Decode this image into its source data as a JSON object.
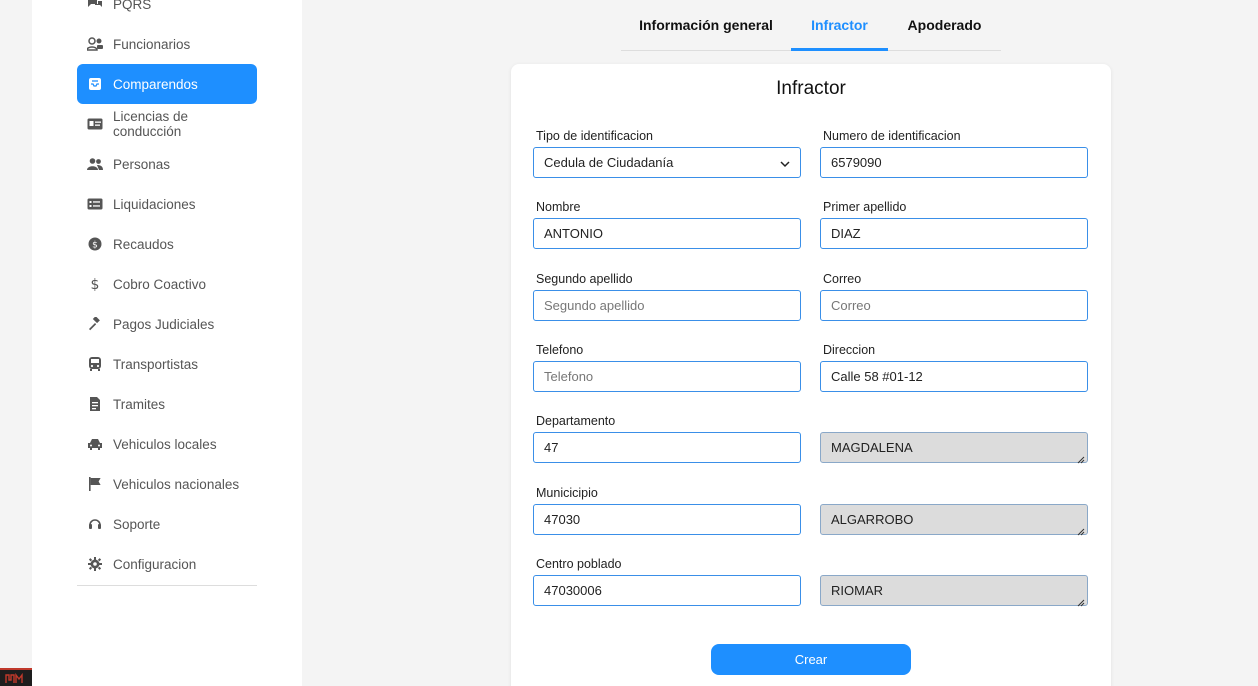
{
  "sidebar": {
    "items": [
      {
        "label": "PQRS",
        "icon": "chat-icon"
      },
      {
        "label": "Funcionarios",
        "icon": "users-icon"
      },
      {
        "label": "Comparendos",
        "icon": "inbox-icon",
        "active": true
      },
      {
        "label": "Licencias de conducción",
        "icon": "id-card-icon"
      },
      {
        "label": "Personas",
        "icon": "people-icon"
      },
      {
        "label": "Liquidaciones",
        "icon": "list-card-icon"
      },
      {
        "label": "Recaudos",
        "icon": "money-icon"
      },
      {
        "label": "Cobro Coactivo",
        "icon": "dollar-icon"
      },
      {
        "label": "Pagos Judiciales",
        "icon": "gavel-icon"
      },
      {
        "label": "Transportistas",
        "icon": "bus-icon"
      },
      {
        "label": "Tramites",
        "icon": "document-icon"
      },
      {
        "label": "Vehiculos locales",
        "icon": "car-icon"
      },
      {
        "label": "Vehiculos nacionales",
        "icon": "flag-icon"
      },
      {
        "label": "Soporte",
        "icon": "headset-icon"
      },
      {
        "label": "Configuracion",
        "icon": "gear-icon"
      }
    ]
  },
  "tabs": [
    {
      "label": "Información general"
    },
    {
      "label": "Infractor",
      "active": true
    },
    {
      "label": "Apoderado"
    }
  ],
  "form": {
    "title": "Infractor",
    "tipo_identificacion": {
      "label": "Tipo de identificacion",
      "value": "Cedula de Ciudadanía"
    },
    "numero_identificacion": {
      "label": "Numero de identificacion",
      "value": "6579090"
    },
    "nombre": {
      "label": "Nombre",
      "value": "ANTONIO"
    },
    "primer_apellido": {
      "label": "Primer apellido",
      "value": "DIAZ"
    },
    "segundo_apellido": {
      "label": "Segundo apellido",
      "value": "",
      "placeholder": "Segundo apellido"
    },
    "correo": {
      "label": "Correo",
      "value": "",
      "placeholder": "Correo"
    },
    "telefono": {
      "label": "Telefono",
      "value": "",
      "placeholder": "Telefono"
    },
    "direccion": {
      "label": "Direccion",
      "value": "Calle 58 #01-12"
    },
    "departamento": {
      "label": "Departamento",
      "value": "47",
      "name_value": "MAGDALENA"
    },
    "municipio": {
      "label": "Municicipio",
      "value": "47030",
      "name_value": "ALGARROBO"
    },
    "centro_poblado": {
      "label": "Centro poblado",
      "value": "47030006",
      "name_value": "RIOMAR"
    },
    "submit_label": "Crear"
  },
  "colors": {
    "accent": "#1e8fff",
    "readonly_bg": "#dcdcdc"
  }
}
